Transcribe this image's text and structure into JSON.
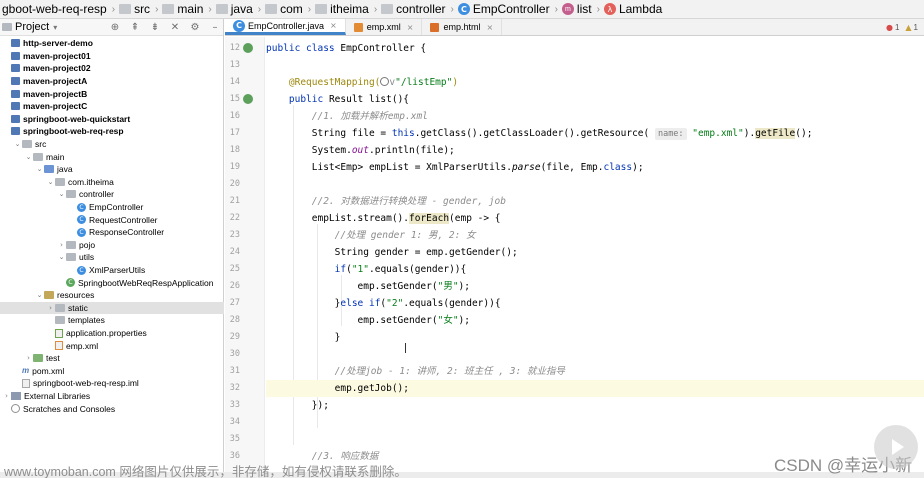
{
  "breadcrumb": {
    "items": [
      {
        "label": "gboot-web-req-resp",
        "icon": "module-icon"
      },
      {
        "label": "src",
        "icon": "folder-icon"
      },
      {
        "label": "main",
        "icon": "folder-icon"
      },
      {
        "label": "java",
        "icon": "folder-icon"
      },
      {
        "label": "com",
        "icon": "folder-icon"
      },
      {
        "label": "itheima",
        "icon": "folder-icon"
      },
      {
        "label": "controller",
        "icon": "folder-icon"
      },
      {
        "label": "EmpController",
        "icon": "class-icon"
      },
      {
        "label": "list",
        "icon": "method-icon"
      },
      {
        "label": "Lambda",
        "icon": "lambda-icon"
      }
    ]
  },
  "project_panel": {
    "title": "Project",
    "tools": [
      "target-icon",
      "collapse-icon",
      "expand-icon",
      "hide-icon",
      "gear-icon",
      "minimize-icon"
    ],
    "tree": [
      {
        "label": "http-server-demo",
        "kind": "module",
        "depth": 0,
        "bold": true
      },
      {
        "label": "maven-project01",
        "kind": "module",
        "depth": 0,
        "bold": true
      },
      {
        "label": "maven-project02",
        "kind": "module",
        "depth": 0,
        "bold": true
      },
      {
        "label": "maven-projectA",
        "kind": "module",
        "depth": 0,
        "bold": true
      },
      {
        "label": "maven-projectB",
        "kind": "module",
        "depth": 0,
        "bold": true
      },
      {
        "label": "maven-projectC",
        "kind": "module",
        "depth": 0,
        "bold": true
      },
      {
        "label": "springboot-web-quickstart",
        "kind": "module",
        "depth": 0,
        "bold": true
      },
      {
        "label": "springboot-web-req-resp",
        "kind": "module",
        "depth": 0,
        "bold": true
      },
      {
        "label": "src",
        "kind": "folder",
        "depth": 1,
        "arrow": "down"
      },
      {
        "label": "main",
        "kind": "folder",
        "depth": 2,
        "arrow": "down"
      },
      {
        "label": "java",
        "kind": "src",
        "depth": 3,
        "arrow": "down"
      },
      {
        "label": "com.itheima",
        "kind": "package",
        "depth": 4,
        "arrow": "down"
      },
      {
        "label": "controller",
        "kind": "package",
        "depth": 5,
        "arrow": "down"
      },
      {
        "label": "EmpController",
        "kind": "class",
        "depth": 6
      },
      {
        "label": "RequestController",
        "kind": "class",
        "depth": 6
      },
      {
        "label": "ResponseController",
        "kind": "class",
        "depth": 6
      },
      {
        "label": "pojo",
        "kind": "package",
        "depth": 5,
        "arrow": "right"
      },
      {
        "label": "utils",
        "kind": "package",
        "depth": 5,
        "arrow": "down"
      },
      {
        "label": "XmlParserUtils",
        "kind": "class",
        "depth": 6
      },
      {
        "label": "SpringbootWebReqRespApplication",
        "kind": "spring",
        "depth": 5
      },
      {
        "label": "resources",
        "kind": "res",
        "depth": 3,
        "arrow": "down"
      },
      {
        "label": "static",
        "kind": "folder",
        "depth": 4,
        "arrow": "right",
        "selected": true
      },
      {
        "label": "templates",
        "kind": "folder",
        "depth": 4
      },
      {
        "label": "application.properties",
        "kind": "props",
        "depth": 4
      },
      {
        "label": "emp.xml",
        "kind": "xml",
        "depth": 4
      },
      {
        "label": "test",
        "kind": "test",
        "depth": 2,
        "arrow": "right"
      },
      {
        "label": "pom.xml",
        "kind": "maven",
        "depth": 1
      },
      {
        "label": "springboot-web-req-resp.iml",
        "kind": "file",
        "depth": 1
      },
      {
        "label": "External Libraries",
        "kind": "lib",
        "depth": 0,
        "arrow": "right"
      },
      {
        "label": "Scratches and Consoles",
        "kind": "scratch",
        "depth": 0
      }
    ]
  },
  "editor": {
    "tabs": [
      {
        "label": "EmpController.java",
        "active": true
      },
      {
        "label": "emp.xml",
        "active": false
      },
      {
        "label": "emp.html",
        "active": false
      }
    ],
    "inspection": {
      "errors": "1",
      "warnings": "1"
    },
    "gutter": [
      "12",
      "13",
      "14",
      "15",
      "16",
      "17",
      "18",
      "19",
      "20",
      "21",
      "22",
      "23",
      "24",
      "25",
      "26",
      "27",
      "28",
      "29",
      "30",
      "31",
      "32",
      "33",
      "34",
      "35",
      "36"
    ],
    "code": {
      "l12_kw": "public class ",
      "l12_rest": "EmpController {",
      "l14_ann": "@RequestMapping(",
      "l14_str": "\"/listEmp\"",
      "l14_end": ")",
      "l15_kw": "public ",
      "l15_rest": "Result list(){",
      "l16_cmt": "//1. 加载并解析emp.xml",
      "l17_a": "String file = ",
      "l17_kw": "this",
      "l17_b": ".getClass().getClassLoader().getResource( ",
      "l17_hint": "name:",
      "l17_str": " \"emp.xml\"",
      "l17_c": ").",
      "l17_hl": "getFile",
      "l17_d": "();",
      "l18_a": "System.",
      "l18_out": "out",
      "l18_b": ".println(file);",
      "l19_a": "List<Emp> empList = XmlParserUtils.",
      "l19_parse": "parse",
      "l19_b": "(file, Emp.",
      "l19_kw": "class",
      "l19_c": ");",
      "l21_cmt": "//2. 对数据进行转换处理 - gender, job",
      "l22_a": "empList.stream().",
      "l22_hl": "forEach",
      "l22_b": "(emp -> {",
      "l23_cmt": "//处理 gender 1: 男, 2: 女",
      "l24": "String gender = emp.getGender();",
      "l25_kw": "if",
      "l25_a": "(",
      "l25_str": "\"1\"",
      "l25_b": ".equals(gender)){",
      "l26_a": "emp.setGender(",
      "l26_str": "\"男\"",
      "l26_b": ");",
      "l27_a": "}",
      "l27_kw": "else if",
      "l27_b": "(",
      "l27_str": "\"2\"",
      "l27_c": ".equals(gender)){",
      "l28_a": "emp.setGender(",
      "l28_str": "\"女\"",
      "l28_b": ");",
      "l29": "}",
      "l31_cmt": "//处理job - 1: 讲师, 2: 班主任 , 3: 就业指导",
      "l32": "emp.getJob();",
      "l33": "});",
      "l36_cmt": "//3. 响应数据"
    }
  },
  "overlay": {
    "watermark": "www.toymoban.com 网络图片仅供展示，非存储，如有侵权请联系删除。",
    "csdn": "CSDN @幸运小新"
  },
  "colors": {
    "keyword": "#0033b3",
    "string": "#067d17",
    "comment": "#8c8c8c",
    "annotation": "#9e880d",
    "selection": "#e1e1e1",
    "tab_accent": "#4083c9"
  }
}
